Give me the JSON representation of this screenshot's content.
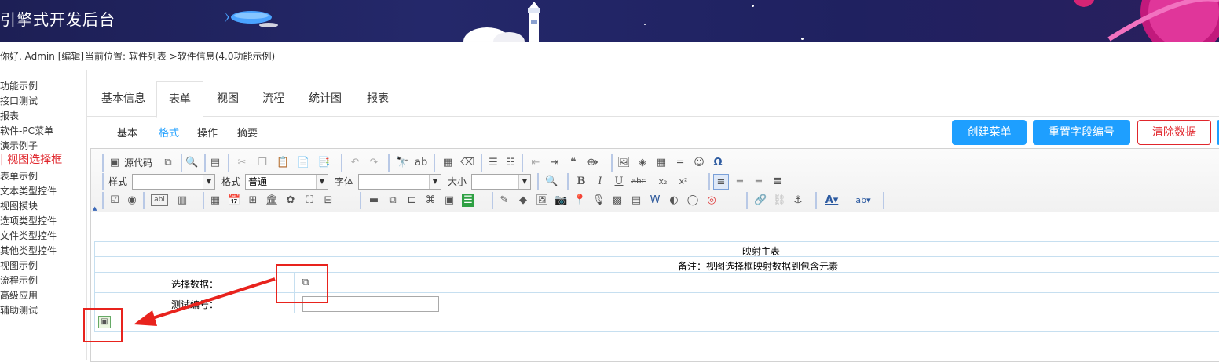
{
  "app": {
    "title": "引擎式开发后台"
  },
  "userbar": {
    "greeting": "你好, Admin [编辑]",
    "location": "当前位置: 软件列表 >软件信息(4.0功能示例)"
  },
  "sidebar": {
    "items": [
      {
        "label": "功能示例"
      },
      {
        "label": "接口测试"
      },
      {
        "label": "报表"
      },
      {
        "label": "软件-PC菜单"
      },
      {
        "label": "演示例子"
      },
      {
        "label": "视图选择框"
      },
      {
        "label": "表单示例"
      },
      {
        "label": "文本类型控件"
      },
      {
        "label": "视图模块"
      },
      {
        "label": "选项类型控件"
      },
      {
        "label": "文件类型控件"
      },
      {
        "label": "其他类型控件"
      },
      {
        "label": "视图示例"
      },
      {
        "label": "流程示例"
      },
      {
        "label": "高级应用"
      },
      {
        "label": "辅助测试"
      }
    ]
  },
  "tabs_primary": [
    "基本信息",
    "表单",
    "视图",
    "流程",
    "统计图",
    "报表"
  ],
  "tabs_secondary": [
    "基本",
    "格式",
    "操作",
    "摘要"
  ],
  "actions": {
    "create_menu": "创建菜单",
    "reset_field_numbers": "重置字段编号",
    "clear_data": "清除数据"
  },
  "toolbar": {
    "source_code": "源代码",
    "style_label": "样式",
    "format_label": "格式",
    "format_value": "普通",
    "font_label": "字体",
    "size_label": "大小",
    "style_value": "",
    "font_value": "",
    "size_value": ""
  },
  "form": {
    "header": "映射主表",
    "note": "备注：视图选择框映射数据到包含元素",
    "select_label": "选择数据：",
    "test_label": "测试编号：",
    "test_value": ""
  }
}
